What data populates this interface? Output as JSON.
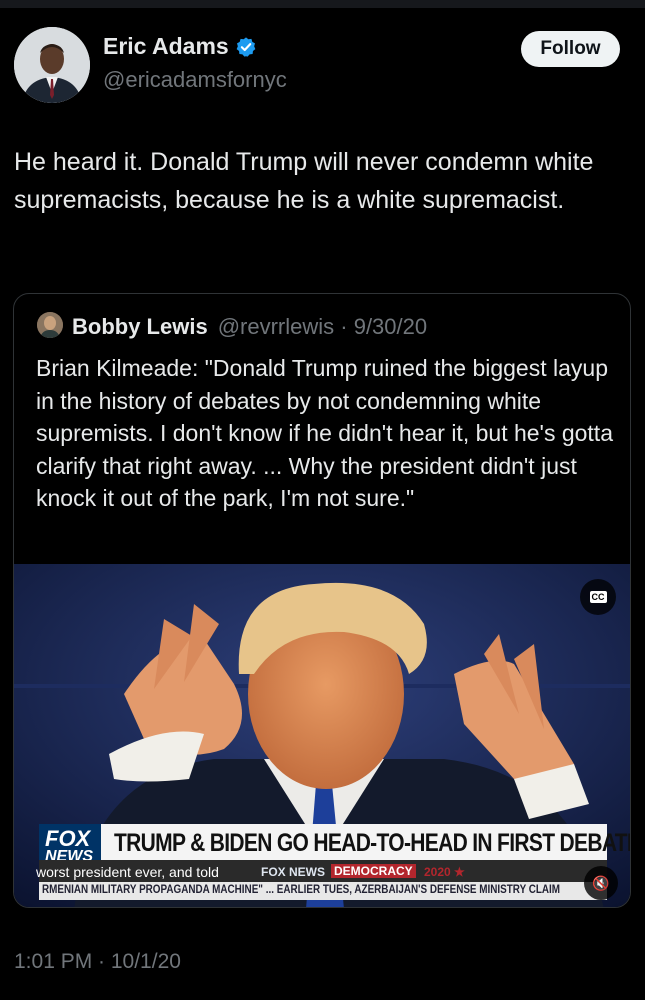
{
  "author": {
    "name": "Eric Adams",
    "handle": "@ericadamsfornyc",
    "verified_color": "#1d9bf0"
  },
  "follow_label": "Follow",
  "tweet_text": "He heard it. Donald Trump will never condemn white supremacists, because he is a white supremacist.",
  "quote": {
    "name": "Bobby Lewis",
    "handle": "@revrrlewis",
    "date": "9/30/20",
    "text": "Brian Kilmeade: \"Donald Trump ruined the biggest layup in the history of debates by not condemning white supremists. I don't know if he didn't hear it, but he's gotta clarify that right away. ... Why the president didn't just knock it out of the park, I'm not sure.\""
  },
  "media": {
    "cc_label": "CC",
    "network_logo_top": "FOX",
    "network_logo_bottom": "NEWS",
    "headline": "TRUMP & BIDEN GO HEAD-TO-HEAD IN FIRST DEBATE",
    "caption": "worst president ever, and told",
    "brand": "FOX NEWS",
    "democracy": "DEMOCRACY",
    "year": "2020 ★",
    "ticker": "RMENIAN MILITARY PROPAGANDA MACHINE\" ...   EARLIER TUES, AZERBAIJAN'S DEFENSE MINISTRY CLAIM",
    "mute_icon": "🔇"
  },
  "timestamp": "1:01 PM · 10/1/20"
}
